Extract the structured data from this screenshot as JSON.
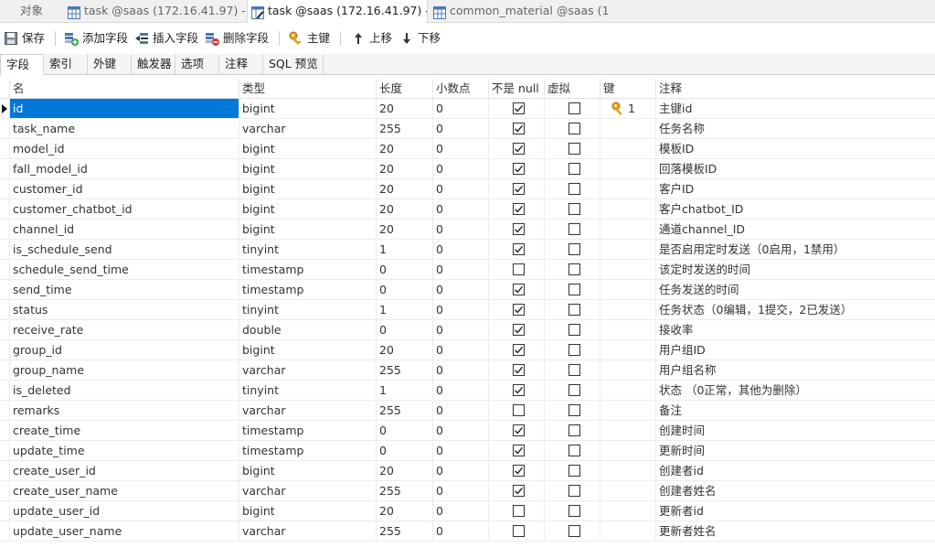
{
  "doc_tabs": [
    {
      "label": "对象",
      "icon": "none"
    },
    {
      "label": "task @saas (172.16.41.97) - ...",
      "icon": "table-icon"
    },
    {
      "label": "task @saas (172.16.41.97) - ...",
      "icon": "table-design-icon"
    },
    {
      "label": "common_material @saas (1...",
      "icon": "table-icon"
    }
  ],
  "toolbar": {
    "save": "保存",
    "add_field": "添加字段",
    "insert_field": "插入字段",
    "delete_field": "删除字段",
    "primary_key": "主键",
    "move_up": "上移",
    "move_down": "下移"
  },
  "sub_tabs": [
    "字段",
    "索引",
    "外键",
    "触发器",
    "选项",
    "注释",
    "SQL 预览"
  ],
  "columns": [
    "名",
    "类型",
    "长度",
    "小数点",
    "不是 null",
    "虚拟",
    "键",
    "注释"
  ],
  "rows": [
    {
      "name": "id",
      "type": "bigint",
      "length": "20",
      "decimal": "0",
      "not_null": true,
      "virtual": false,
      "key": "1",
      "comment": "主键id"
    },
    {
      "name": "task_name",
      "type": "varchar",
      "length": "255",
      "decimal": "0",
      "not_null": true,
      "virtual": false,
      "key": "",
      "comment": "任务名称"
    },
    {
      "name": "model_id",
      "type": "bigint",
      "length": "20",
      "decimal": "0",
      "not_null": true,
      "virtual": false,
      "key": "",
      "comment": "模板ID"
    },
    {
      "name": "fall_model_id",
      "type": "bigint",
      "length": "20",
      "decimal": "0",
      "not_null": true,
      "virtual": false,
      "key": "",
      "comment": "回落模板ID"
    },
    {
      "name": "customer_id",
      "type": "bigint",
      "length": "20",
      "decimal": "0",
      "not_null": true,
      "virtual": false,
      "key": "",
      "comment": "客户ID"
    },
    {
      "name": "customer_chatbot_id",
      "type": "bigint",
      "length": "20",
      "decimal": "0",
      "not_null": true,
      "virtual": false,
      "key": "",
      "comment": "客户chatbot_ID"
    },
    {
      "name": "channel_id",
      "type": "bigint",
      "length": "20",
      "decimal": "0",
      "not_null": true,
      "virtual": false,
      "key": "",
      "comment": "通道channel_ID"
    },
    {
      "name": "is_schedule_send",
      "type": "tinyint",
      "length": "1",
      "decimal": "0",
      "not_null": true,
      "virtual": false,
      "key": "",
      "comment": "是否启用定时发送（0启用，1禁用）"
    },
    {
      "name": "schedule_send_time",
      "type": "timestamp",
      "length": "0",
      "decimal": "0",
      "not_null": false,
      "virtual": false,
      "key": "",
      "comment": "该定时发送的时间"
    },
    {
      "name": "send_time",
      "type": "timestamp",
      "length": "0",
      "decimal": "0",
      "not_null": true,
      "virtual": false,
      "key": "",
      "comment": "任务发送的时间"
    },
    {
      "name": "status",
      "type": "tinyint",
      "length": "1",
      "decimal": "0",
      "not_null": true,
      "virtual": false,
      "key": "",
      "comment": "任务状态（0编辑，1提交，2已发送）"
    },
    {
      "name": "receive_rate",
      "type": "double",
      "length": "0",
      "decimal": "0",
      "not_null": true,
      "virtual": false,
      "key": "",
      "comment": "接收率"
    },
    {
      "name": "group_id",
      "type": "bigint",
      "length": "20",
      "decimal": "0",
      "not_null": true,
      "virtual": false,
      "key": "",
      "comment": "用户组ID"
    },
    {
      "name": "group_name",
      "type": "varchar",
      "length": "255",
      "decimal": "0",
      "not_null": true,
      "virtual": false,
      "key": "",
      "comment": "用户组名称"
    },
    {
      "name": "is_deleted",
      "type": "tinyint",
      "length": "1",
      "decimal": "0",
      "not_null": true,
      "virtual": false,
      "key": "",
      "comment": "状态 （0正常，其他为删除）"
    },
    {
      "name": "remarks",
      "type": "varchar",
      "length": "255",
      "decimal": "0",
      "not_null": false,
      "virtual": false,
      "key": "",
      "comment": "备注"
    },
    {
      "name": "create_time",
      "type": "timestamp",
      "length": "0",
      "decimal": "0",
      "not_null": true,
      "virtual": false,
      "key": "",
      "comment": "创建时间"
    },
    {
      "name": "update_time",
      "type": "timestamp",
      "length": "0",
      "decimal": "0",
      "not_null": true,
      "virtual": false,
      "key": "",
      "comment": "更新时间"
    },
    {
      "name": "create_user_id",
      "type": "bigint",
      "length": "20",
      "decimal": "0",
      "not_null": true,
      "virtual": false,
      "key": "",
      "comment": "创建者id"
    },
    {
      "name": "create_user_name",
      "type": "varchar",
      "length": "255",
      "decimal": "0",
      "not_null": true,
      "virtual": false,
      "key": "",
      "comment": "创建者姓名"
    },
    {
      "name": "update_user_id",
      "type": "bigint",
      "length": "20",
      "decimal": "0",
      "not_null": false,
      "virtual": false,
      "key": "",
      "comment": "更新者id"
    },
    {
      "name": "update_user_name",
      "type": "varchar",
      "length": "255",
      "decimal": "0",
      "not_null": false,
      "virtual": false,
      "key": "",
      "comment": "更新者姓名"
    }
  ],
  "colors": {
    "selection": "#0078d7",
    "key_icon": "#e3a21a"
  }
}
